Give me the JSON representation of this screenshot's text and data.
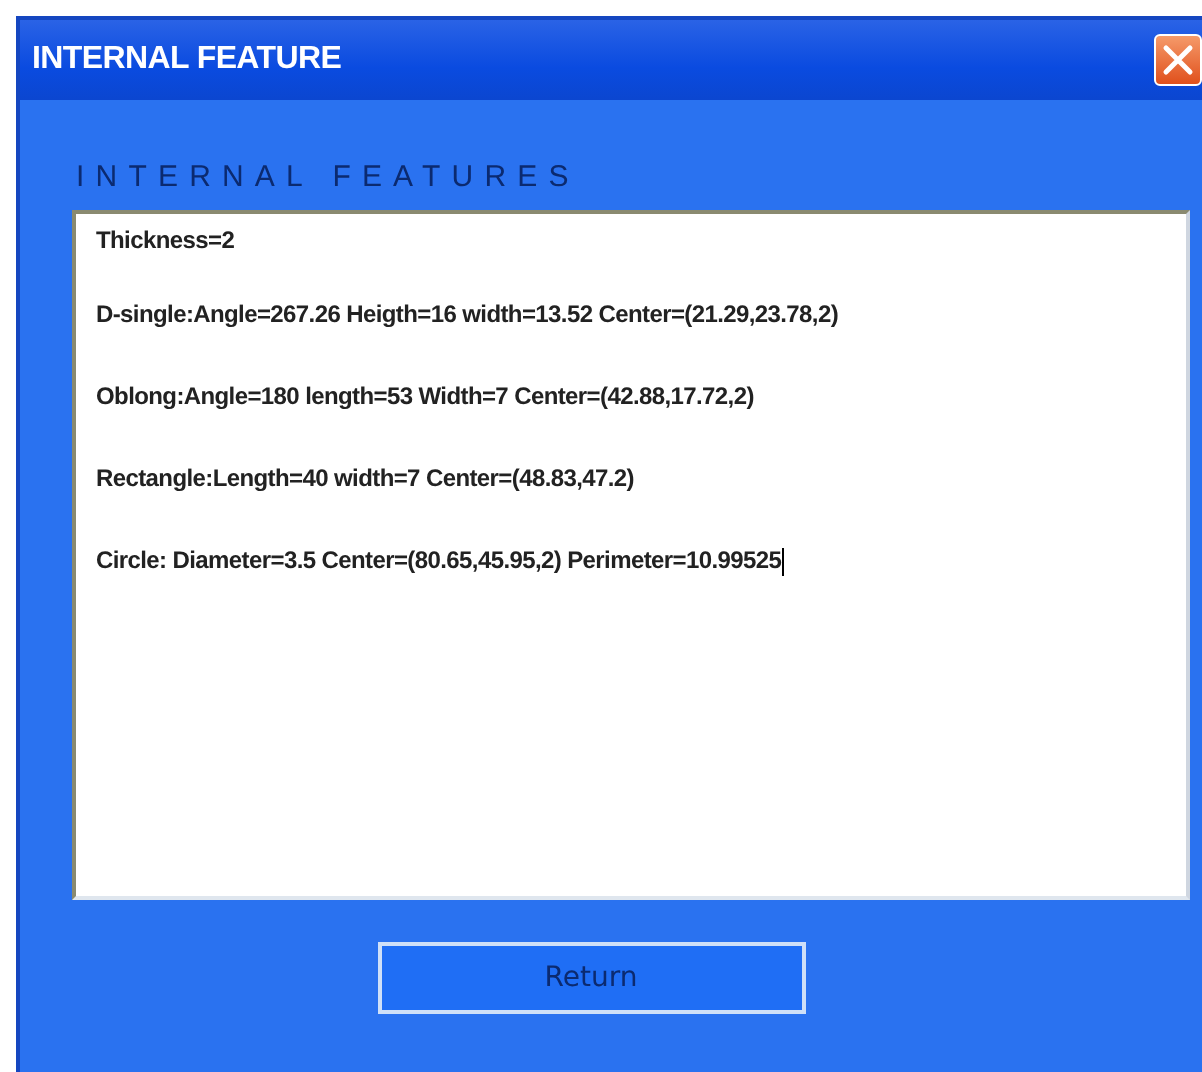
{
  "window": {
    "title": "INTERNAL FEATURE"
  },
  "heading": "INTERNAL FEATURES",
  "features": [
    "Thickness=2",
    "D-single:Angle=267.26 Heigth=16 width=13.52 Center=(21.29,23.78,2)",
    "Oblong:Angle=180 length=53 Width=7 Center=(42.88,17.72,2)",
    "Rectangle:Length=40 width=7 Center=(48.83,47.2)",
    "Circle: Diameter=3.5 Center=(80.65,45.95,2) Perimeter=10.99525"
  ],
  "buttons": [
    "Return"
  ]
}
